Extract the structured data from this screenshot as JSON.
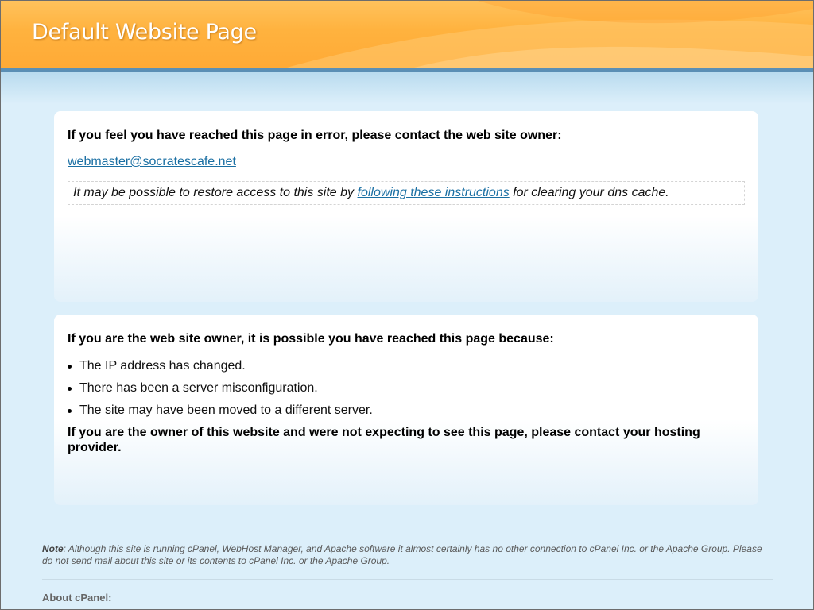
{
  "header": {
    "title": "Default Website Page"
  },
  "error_box": {
    "heading": "If you feel you have reached this page in error, please contact the web site owner:",
    "email": "webmaster@socratescafe.net",
    "dns_note_before": "It may be possible to restore access to this site by ",
    "dns_link": "following these instructions",
    "dns_note_after": " for clearing your dns cache."
  },
  "owner_box": {
    "heading": "If you are the web site owner, it is possible you have reached this page because:",
    "reasons": [
      "The IP address has changed.",
      "There has been a server misconfiguration.",
      "The site may have been moved to a different server."
    ],
    "contact_note": "If you are the owner of this website and were not expecting to see this page, please contact your hosting provider."
  },
  "footer": {
    "note_label": "Note",
    "note_text": ": Although this site is running cPanel, WebHost Manager, and Apache software it almost certainly has no other connection to cPanel Inc. or the Apache Group. Please do not send mail about this site or its contents to cPanel Inc. or the Apache Group.",
    "about_heading": "About cPanel:"
  },
  "colors": {
    "header_orange": "#ffb23e",
    "header_bar_blue": "#5b8fb5",
    "link_blue": "#1a6fa3",
    "page_background": "#dceffa"
  }
}
